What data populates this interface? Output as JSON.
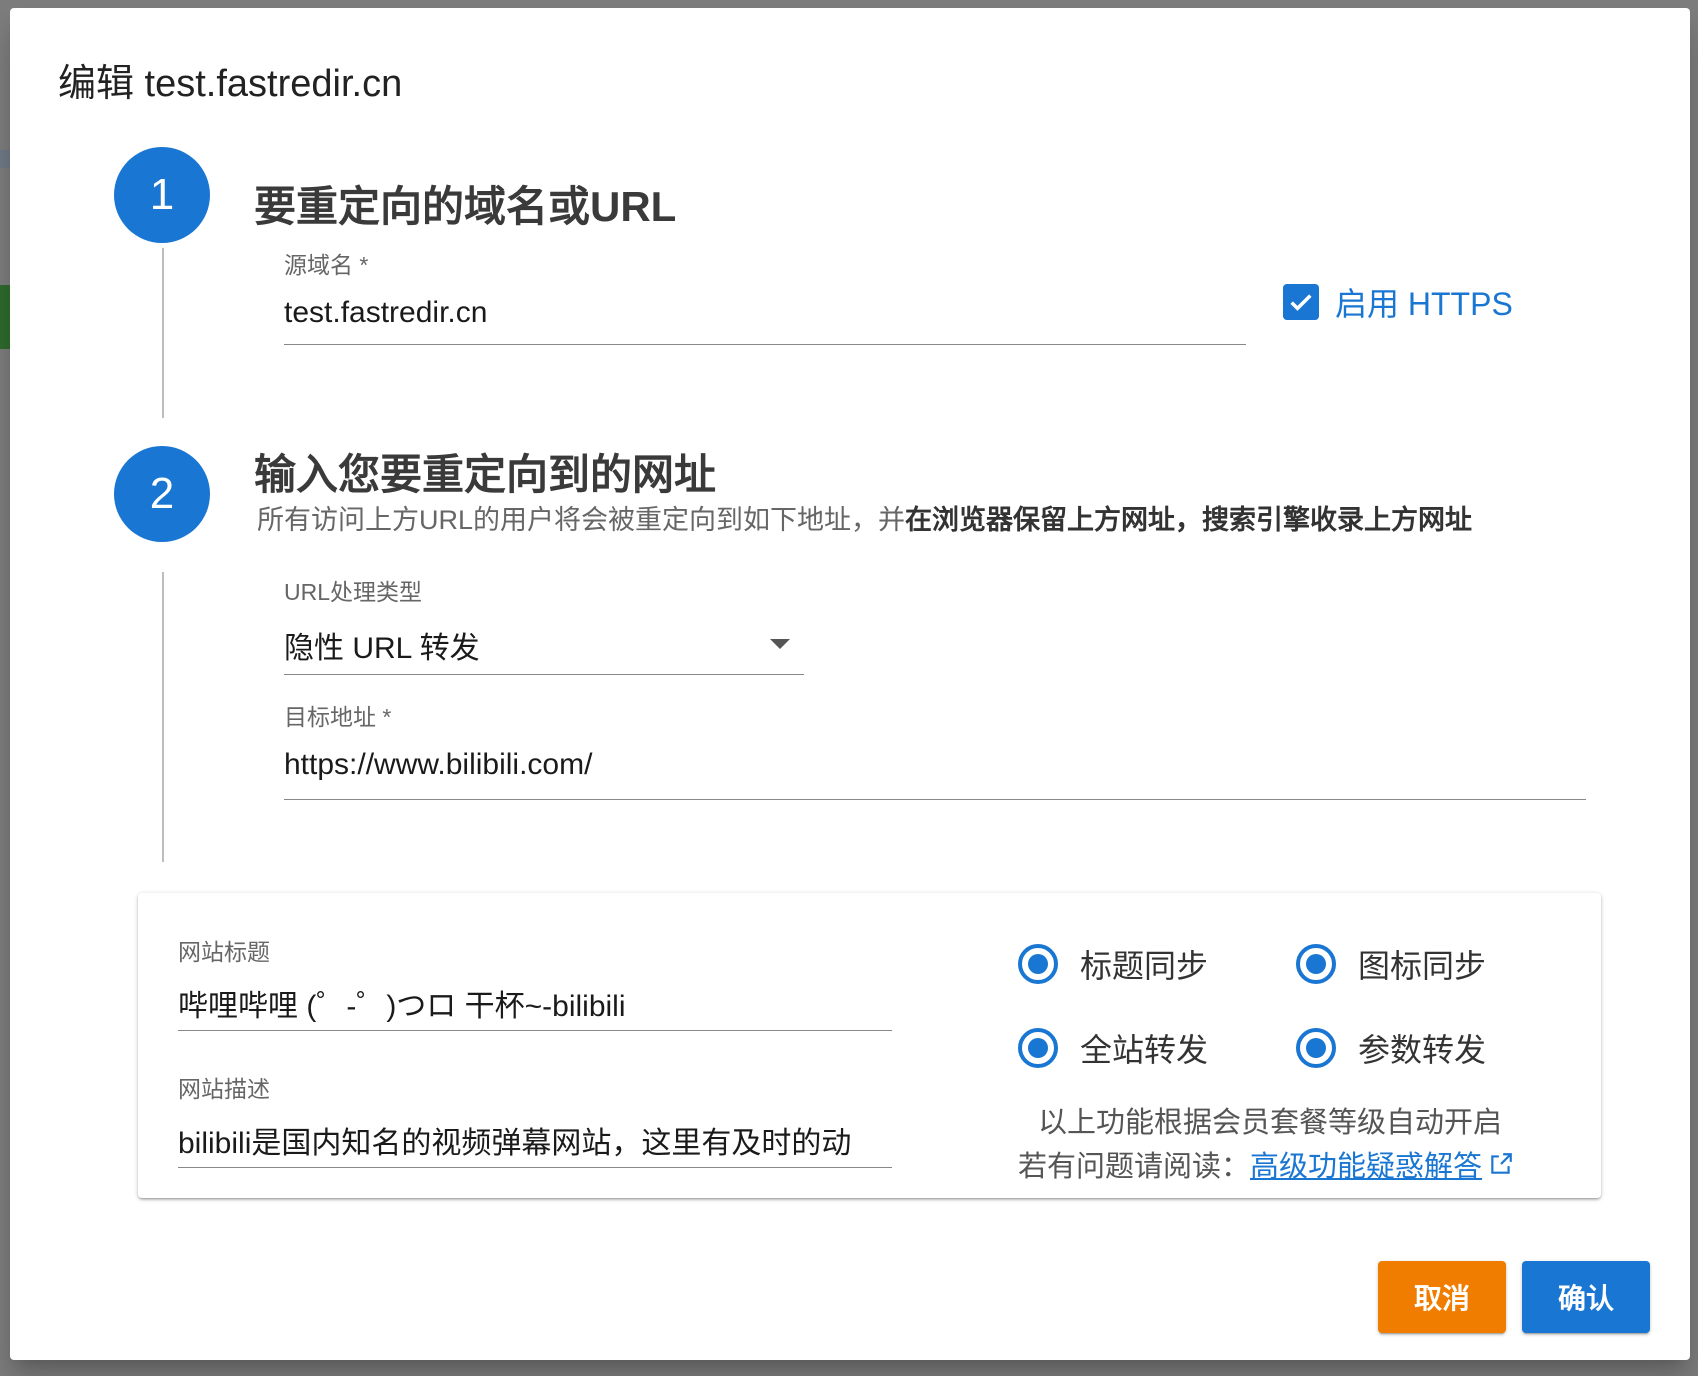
{
  "dialog": {
    "title": "编辑 test.fastredir.cn"
  },
  "step1": {
    "number": "1",
    "title": "要重定向的域名或URL",
    "source_label": "源域名 *",
    "source_value": "test.fastredir.cn",
    "https_label": "启用 HTTPS",
    "https_checked": true
  },
  "step2": {
    "number": "2",
    "title": "输入您要重定向到的网址",
    "desc_normal": "所有访问上方URL的用户将会被重定向到如下地址，并",
    "desc_bold": "在浏览器保留上方网址，搜索引擎收录上方网址",
    "type_label": "URL处理类型",
    "type_value": "隐性 URL 转发",
    "target_label": "目标地址 *",
    "target_value": "https://www.bilibili.com/"
  },
  "options": {
    "site_title_label": "网站标题",
    "site_title_value": "哔哩哔哩 (゜-゜)つロ 干杯~-bilibili",
    "site_desc_label": "网站描述",
    "site_desc_value": "bilibili是国内知名的视频弹幕网站，这里有及时的动",
    "radio_title_sync": "标题同步",
    "radio_icon_sync": "图标同步",
    "radio_site_forward": "全站转发",
    "radio_param_forward": "参数转发",
    "note_line1": "以上功能根据会员套餐等级自动开启",
    "note_prefix": "若有问题请阅读：",
    "faq_link": "高级功能疑惑解答"
  },
  "buttons": {
    "cancel": "取消",
    "confirm": "确认"
  },
  "colors": {
    "primary": "#1976d2",
    "cancel": "#f07c00"
  }
}
